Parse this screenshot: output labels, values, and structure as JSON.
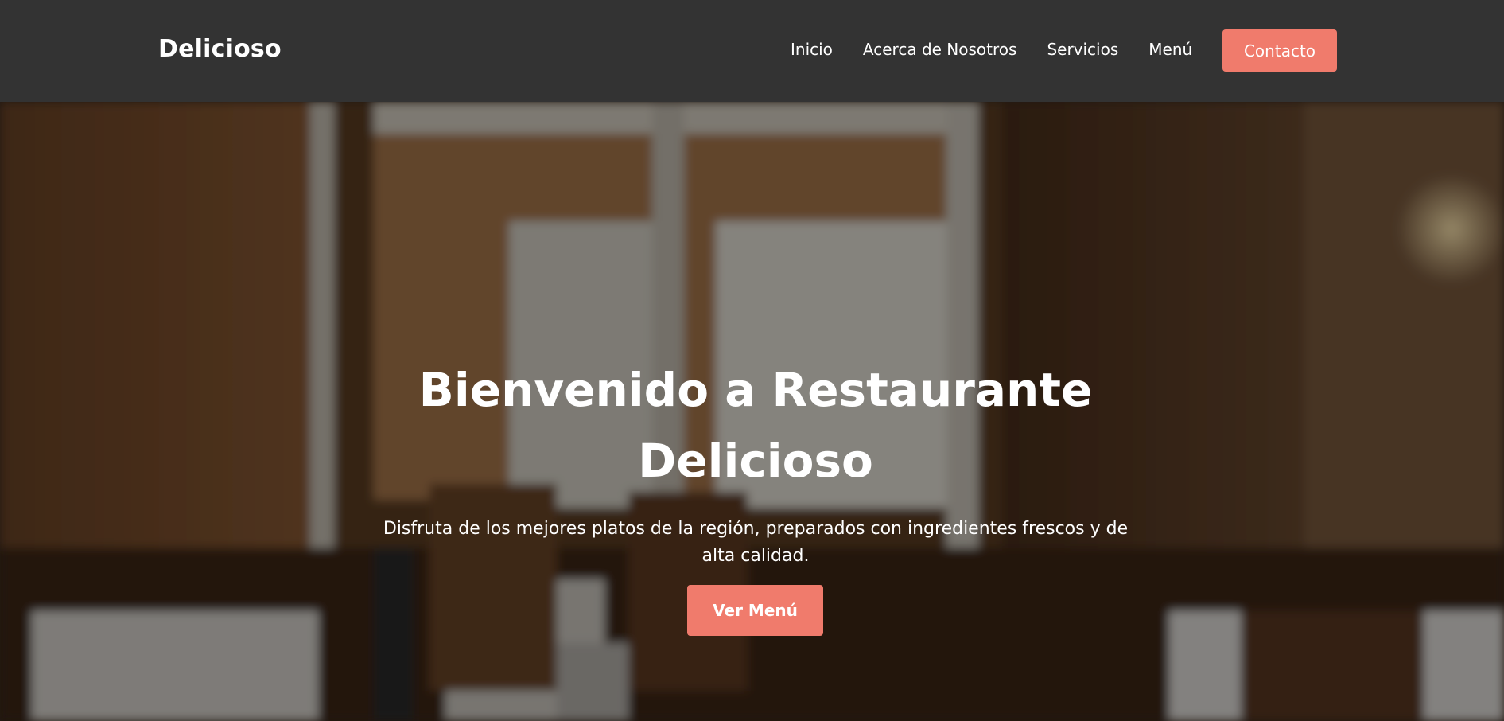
{
  "header": {
    "brand": "Delicioso",
    "nav": {
      "inicio": "Inicio",
      "acerca": "Acerca de Nosotros",
      "servicios": "Servicios",
      "menu": "Menú"
    },
    "cta_label": "Contacto"
  },
  "hero": {
    "title_line1": "Bienvenido a Restaurante",
    "title_line2": "Delicioso",
    "subtitle_line1": "Disfruta de los mejores platos de la región, preparados con ingredientes frescos y de",
    "subtitle_line2": "alta calidad.",
    "cta_label": "Ver Menú",
    "background_image": "restaurant-interior-photo"
  },
  "colors": {
    "header_bg": "#333333",
    "accent": "#f07b6c",
    "text": "#ffffff"
  }
}
